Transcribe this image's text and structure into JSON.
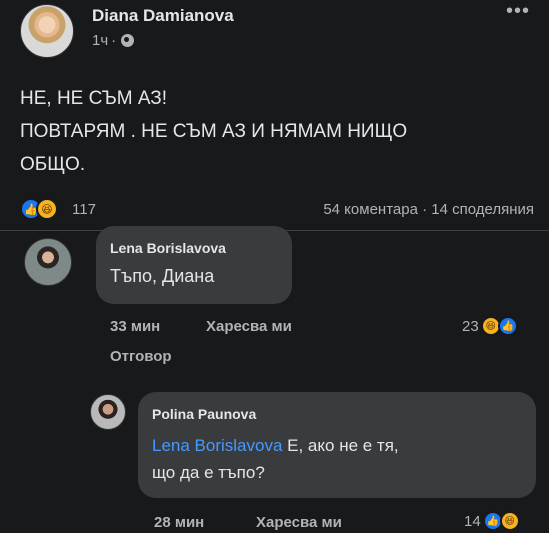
{
  "post": {
    "author": "Diana Damianova",
    "time": "1ч",
    "separator": "·",
    "more": "•••",
    "text_line1": "НЕ, НЕ СЪМ АЗ!",
    "text_line2": "ПОВТАРЯМ . НЕ СЪМ АЗ И НЯМАМ НИЩО",
    "text_line3": "ОБЩО.",
    "reaction_count": "117",
    "stats": "54 коментара · 14 споделяния",
    "icons": {
      "visibility": "globe-icon",
      "like": "like-icon",
      "haha": "haha-icon"
    }
  },
  "comment1": {
    "author": "Lena Borislavova",
    "text": "Тъпо, Диана",
    "time": "33 мин",
    "like_label": "Харесва ми",
    "reply_label": "Отговор",
    "reaction_count": "23"
  },
  "reply1": {
    "author": "Polina Paunova",
    "mention": "Lena Borislavova",
    "text_after_mention": " Е, ако не е тя,",
    "text_line2": "що да е тъпо?",
    "time": "28 мин",
    "like_label": "Харесва ми",
    "reaction_count": "14"
  },
  "colors": {
    "background": "#18191a",
    "bubble": "#3a3b3c",
    "text": "#e4e6eb",
    "muted": "#b0b3b8",
    "mention": "#4599ff",
    "like": "#1877f2",
    "haha": "#f7b125"
  }
}
